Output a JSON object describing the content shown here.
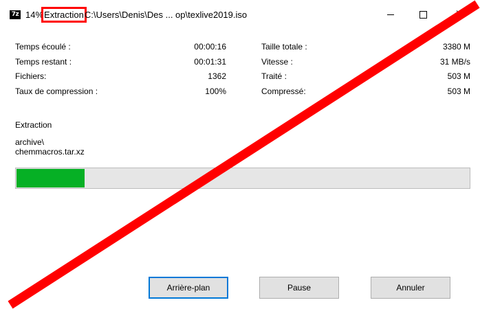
{
  "window": {
    "icon_text": "7z",
    "title": {
      "percent": "14%",
      "operation": "Extraction",
      "path": "C:\\Users\\Denis\\Des ... op\\texlive2019.iso"
    }
  },
  "stats": {
    "left": [
      {
        "label": "Temps écoulé :",
        "value": "00:00:16"
      },
      {
        "label": "Temps restant :",
        "value": "00:01:31"
      },
      {
        "label": "Fichiers:",
        "value": "1362"
      },
      {
        "label": "Taux de compression :",
        "value": "100%"
      }
    ],
    "right": [
      {
        "label": "Taille totale :",
        "value": "3380 M"
      },
      {
        "label": "Vitesse :",
        "value": "31 MB/s"
      },
      {
        "label": "Traité :",
        "value": "503 M"
      },
      {
        "label": "Compressé:",
        "value": "503 M"
      }
    ]
  },
  "operation_label": "Extraction",
  "current_file": {
    "line1": "archive\\",
    "line2": "chemmacros.tar.xz"
  },
  "progress": {
    "fraction": 0.15,
    "color": "#06b025"
  },
  "buttons": {
    "background": "Arrière-plan",
    "pause": "Pause",
    "cancel": "Annuler"
  },
  "colors": {
    "highlight": "#ff0000",
    "strike": "#ff0000"
  }
}
